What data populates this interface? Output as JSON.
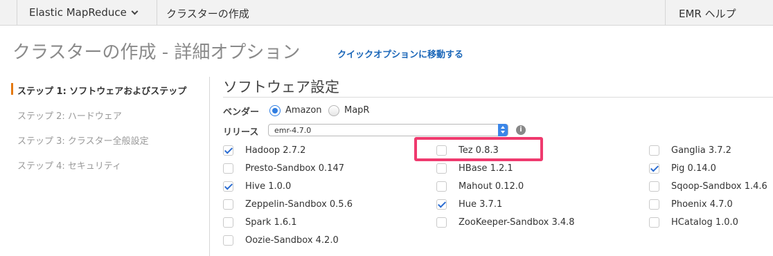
{
  "topbar": {
    "service_menu": "Elastic MapReduce",
    "breadcrumb": "クラスターの作成",
    "help": "EMR ヘルプ"
  },
  "page": {
    "title": "クラスターの作成 - 詳細オプション",
    "quick_link": "クイックオプションに移動する"
  },
  "steps": [
    {
      "label": "ステップ 1: ソフトウェアおよびステップ",
      "active": true
    },
    {
      "label": "ステップ 2: ハードウェア",
      "active": false
    },
    {
      "label": "ステップ 3: クラスター全般設定",
      "active": false
    },
    {
      "label": "ステップ 4: セキュリティ",
      "active": false
    }
  ],
  "software": {
    "title": "ソフトウェア設定",
    "vendor_label": "ベンダー",
    "vendor_options": [
      {
        "label": "Amazon",
        "selected": true
      },
      {
        "label": "MapR",
        "selected": false
      }
    ],
    "release_label": "リリース",
    "release_value": "emr-4.7.0",
    "info_icon": "info-icon",
    "applications": [
      {
        "label": "Hadoop 2.7.2",
        "checked": true
      },
      {
        "label": "Tez 0.8.3",
        "checked": false
      },
      {
        "label": "Ganglia 3.7.2",
        "checked": false
      },
      {
        "label": "Presto-Sandbox 0.147",
        "checked": false
      },
      {
        "label": "HBase 1.2.1",
        "checked": false
      },
      {
        "label": "Pig 0.14.0",
        "checked": true
      },
      {
        "label": "Hive 1.0.0",
        "checked": true
      },
      {
        "label": "Mahout 0.12.0",
        "checked": false
      },
      {
        "label": "Sqoop-Sandbox 1.4.6",
        "checked": false
      },
      {
        "label": "Zeppelin-Sandbox 0.5.6",
        "checked": false
      },
      {
        "label": "Hue 3.7.1",
        "checked": true
      },
      {
        "label": "Phoenix 4.7.0",
        "checked": false
      },
      {
        "label": "Spark 1.6.1",
        "checked": false
      },
      {
        "label": "ZooKeeper-Sandbox 3.4.8",
        "checked": false
      },
      {
        "label": "HCatalog 1.0.0",
        "checked": false
      },
      {
        "label": "Oozie-Sandbox 4.2.0",
        "checked": false
      }
    ]
  },
  "colors": {
    "accent": "#e47911",
    "link": "#1a66b8",
    "check": "#2a6bd1",
    "highlight": "#ef3a6e"
  }
}
